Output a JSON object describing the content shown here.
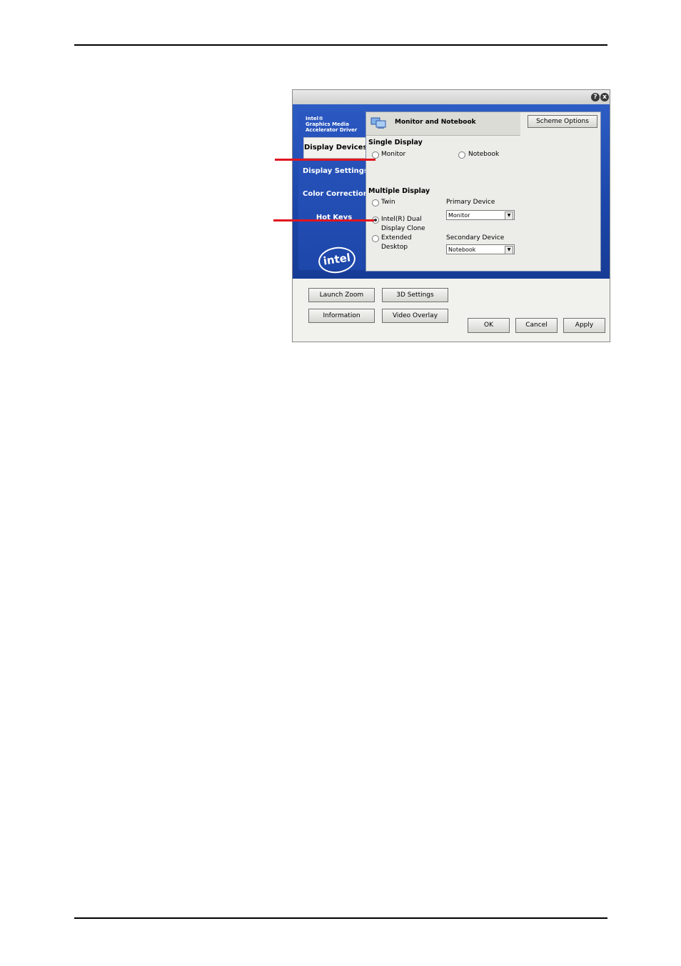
{
  "window": {
    "help_label": "?",
    "close_label": "x",
    "brand_lines": [
      "Intel®",
      "Graphics Media",
      "Accelerator Driver"
    ],
    "logo_text": "intel",
    "nav": [
      {
        "label": "Display Devices"
      },
      {
        "label": "Display Settings"
      },
      {
        "label": "Color Correction"
      },
      {
        "label": "Hot Keys"
      }
    ],
    "panel": {
      "title": "Monitor and Notebook",
      "scheme_button": "Scheme Options",
      "single_display": {
        "heading": "Single Display",
        "monitor": "Monitor",
        "notebook": "Notebook"
      },
      "multiple_display": {
        "heading": "Multiple Display",
        "twin": "Twin",
        "dual_clone_line1": "Intel(R) Dual",
        "dual_clone_line2": "Display Clone",
        "extended_line1": "Extended",
        "extended_line2": "Desktop",
        "primary_label": "Primary Device",
        "primary_value": "Monitor",
        "secondary_label": "Secondary Device",
        "secondary_value": "Notebook"
      }
    },
    "buttons": {
      "launch_zoom": "Launch Zoom",
      "settings_3d": "3D Settings",
      "information": "Information",
      "video_overlay": "Video Overlay",
      "ok": "OK",
      "cancel": "Cancel",
      "apply": "Apply"
    }
  },
  "colors": {
    "frame_blue": "#1b45a8",
    "callout_red": "#e0151f"
  }
}
